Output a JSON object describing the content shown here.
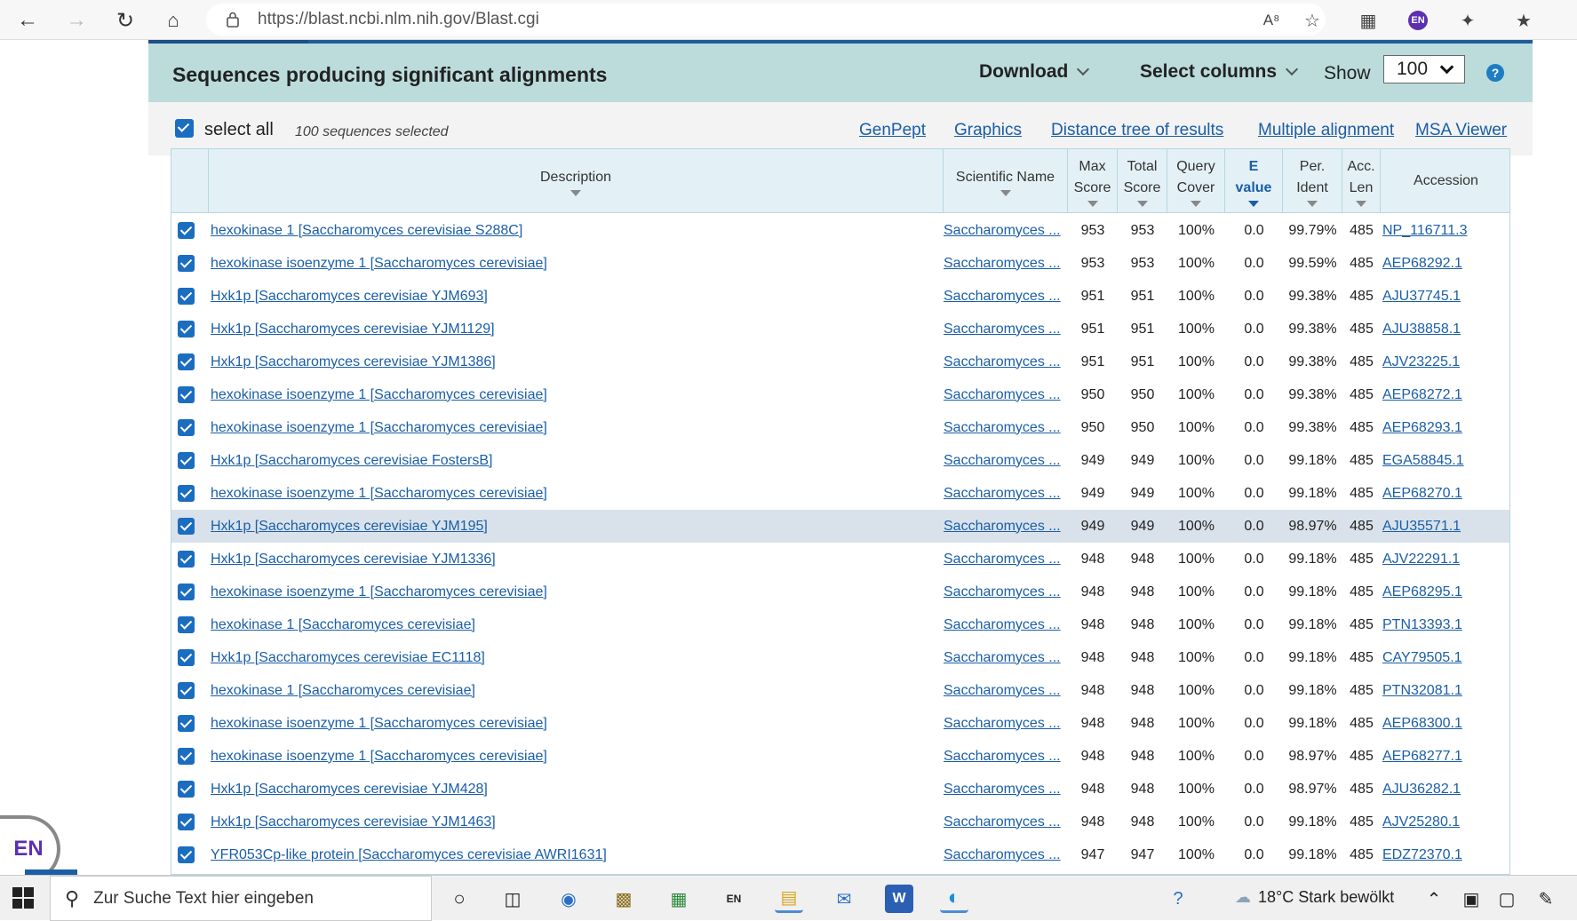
{
  "browser": {
    "url": "https://blast.ncbi.nlm.nih.gov/Blast.cgi",
    "profile_initials": "EN"
  },
  "header": {
    "title": "Sequences producing significant alignments",
    "download_label": "Download",
    "select_columns_label": "Select columns",
    "show_label": "Show",
    "show_value": "100",
    "help_label": "?"
  },
  "controls": {
    "select_all_label": "select all",
    "selected_count": "100 sequences selected",
    "links": [
      "GenPept",
      "Graphics",
      "Distance tree of results",
      "Multiple alignment",
      "MSA Viewer"
    ]
  },
  "table": {
    "columns": {
      "description": "Description",
      "scientific_name": "Scientific Name",
      "max_score_1": "Max",
      "max_score_2": "Score",
      "total_score_1": "Total",
      "total_score_2": "Score",
      "query_cover_1": "Query",
      "query_cover_2": "Cover",
      "evalue_1": "E",
      "evalue_2": "value",
      "per_ident_1": "Per.",
      "per_ident_2": "Ident",
      "acc_len_1": "Acc.",
      "acc_len_2": "Len",
      "accession": "Accession"
    },
    "rows": [
      {
        "desc": "hexokinase 1 [Saccharomyces cerevisiae S288C]",
        "sci": "Saccharomyces ...",
        "max": "953",
        "total": "953",
        "cover": "100%",
        "evalue": "0.0",
        "ident": "99.79%",
        "len": "485",
        "acc": "NP_116711.3"
      },
      {
        "desc": "hexokinase isoenzyme 1 [Saccharomyces cerevisiae]",
        "sci": "Saccharomyces ...",
        "max": "953",
        "total": "953",
        "cover": "100%",
        "evalue": "0.0",
        "ident": "99.59%",
        "len": "485",
        "acc": "AEP68292.1"
      },
      {
        "desc": "Hxk1p [Saccharomyces cerevisiae YJM693]",
        "sci": "Saccharomyces ...",
        "max": "951",
        "total": "951",
        "cover": "100%",
        "evalue": "0.0",
        "ident": "99.38%",
        "len": "485",
        "acc": "AJU37745.1"
      },
      {
        "desc": "Hxk1p [Saccharomyces cerevisiae YJM1129]",
        "sci": "Saccharomyces ...",
        "max": "951",
        "total": "951",
        "cover": "100%",
        "evalue": "0.0",
        "ident": "99.38%",
        "len": "485",
        "acc": "AJU38858.1"
      },
      {
        "desc": "Hxk1p [Saccharomyces cerevisiae YJM1386]",
        "sci": "Saccharomyces ...",
        "max": "951",
        "total": "951",
        "cover": "100%",
        "evalue": "0.0",
        "ident": "99.38%",
        "len": "485",
        "acc": "AJV23225.1"
      },
      {
        "desc": "hexokinase isoenzyme 1 [Saccharomyces cerevisiae]",
        "sci": "Saccharomyces ...",
        "max": "950",
        "total": "950",
        "cover": "100%",
        "evalue": "0.0",
        "ident": "99.38%",
        "len": "485",
        "acc": "AEP68272.1"
      },
      {
        "desc": "hexokinase isoenzyme 1 [Saccharomyces cerevisiae]",
        "sci": "Saccharomyces ...",
        "max": "950",
        "total": "950",
        "cover": "100%",
        "evalue": "0.0",
        "ident": "99.38%",
        "len": "485",
        "acc": "AEP68293.1"
      },
      {
        "desc": "Hxk1p [Saccharomyces cerevisiae FostersB]",
        "sci": "Saccharomyces ...",
        "max": "949",
        "total": "949",
        "cover": "100%",
        "evalue": "0.0",
        "ident": "99.18%",
        "len": "485",
        "acc": "EGA58845.1"
      },
      {
        "desc": "hexokinase isoenzyme 1 [Saccharomyces cerevisiae]",
        "sci": "Saccharomyces ...",
        "max": "949",
        "total": "949",
        "cover": "100%",
        "evalue": "0.0",
        "ident": "99.18%",
        "len": "485",
        "acc": "AEP68270.1"
      },
      {
        "desc": "Hxk1p [Saccharomyces cerevisiae YJM195]",
        "sci": "Saccharomyces ...",
        "max": "949",
        "total": "949",
        "cover": "100%",
        "evalue": "0.0",
        "ident": "98.97%",
        "len": "485",
        "acc": "AJU35571.1",
        "highlight": true
      },
      {
        "desc": "Hxk1p [Saccharomyces cerevisiae YJM1336]",
        "sci": "Saccharomyces ...",
        "max": "948",
        "total": "948",
        "cover": "100%",
        "evalue": "0.0",
        "ident": "99.18%",
        "len": "485",
        "acc": "AJV22291.1"
      },
      {
        "desc": "hexokinase isoenzyme 1 [Saccharomyces cerevisiae]",
        "sci": "Saccharomyces ...",
        "max": "948",
        "total": "948",
        "cover": "100%",
        "evalue": "0.0",
        "ident": "99.18%",
        "len": "485",
        "acc": "AEP68295.1"
      },
      {
        "desc": "hexokinase 1 [Saccharomyces cerevisiae]",
        "sci": "Saccharomyces ...",
        "max": "948",
        "total": "948",
        "cover": "100%",
        "evalue": "0.0",
        "ident": "99.18%",
        "len": "485",
        "acc": "PTN13393.1"
      },
      {
        "desc": "Hxk1p [Saccharomyces cerevisiae EC1118]",
        "sci": "Saccharomyces ...",
        "max": "948",
        "total": "948",
        "cover": "100%",
        "evalue": "0.0",
        "ident": "99.18%",
        "len": "485",
        "acc": "CAY79505.1"
      },
      {
        "desc": "hexokinase 1 [Saccharomyces cerevisiae]",
        "sci": "Saccharomyces ...",
        "max": "948",
        "total": "948",
        "cover": "100%",
        "evalue": "0.0",
        "ident": "99.18%",
        "len": "485",
        "acc": "PTN32081.1"
      },
      {
        "desc": "hexokinase isoenzyme 1 [Saccharomyces cerevisiae]",
        "sci": "Saccharomyces ...",
        "max": "948",
        "total": "948",
        "cover": "100%",
        "evalue": "0.0",
        "ident": "99.18%",
        "len": "485",
        "acc": "AEP68300.1"
      },
      {
        "desc": "hexokinase isoenzyme 1 [Saccharomyces cerevisiae]",
        "sci": "Saccharomyces ...",
        "max": "948",
        "total": "948",
        "cover": "100%",
        "evalue": "0.0",
        "ident": "98.97%",
        "len": "485",
        "acc": "AEP68277.1"
      },
      {
        "desc": "Hxk1p [Saccharomyces cerevisiae YJM428]",
        "sci": "Saccharomyces ...",
        "max": "948",
        "total": "948",
        "cover": "100%",
        "evalue": "0.0",
        "ident": "98.97%",
        "len": "485",
        "acc": "AJU36282.1"
      },
      {
        "desc": "Hxk1p [Saccharomyces cerevisiae YJM1463]",
        "sci": "Saccharomyces ...",
        "max": "948",
        "total": "948",
        "cover": "100%",
        "evalue": "0.0",
        "ident": "99.18%",
        "len": "485",
        "acc": "AJV25280.1"
      },
      {
        "desc": "YFR053Cp-like protein [Saccharomyces cerevisiae AWRI1631]",
        "sci": "Saccharomyces ...",
        "max": "947",
        "total": "947",
        "cover": "100%",
        "evalue": "0.0",
        "ident": "99.18%",
        "len": "485",
        "acc": "EDZ72370.1"
      }
    ]
  },
  "floating": {
    "lang_badge": "EN"
  },
  "taskbar": {
    "search_placeholder": "Zur Suche Text hier eingeben",
    "lang_icon": "EN",
    "weather": "18°C  Stark bewölkt"
  }
}
